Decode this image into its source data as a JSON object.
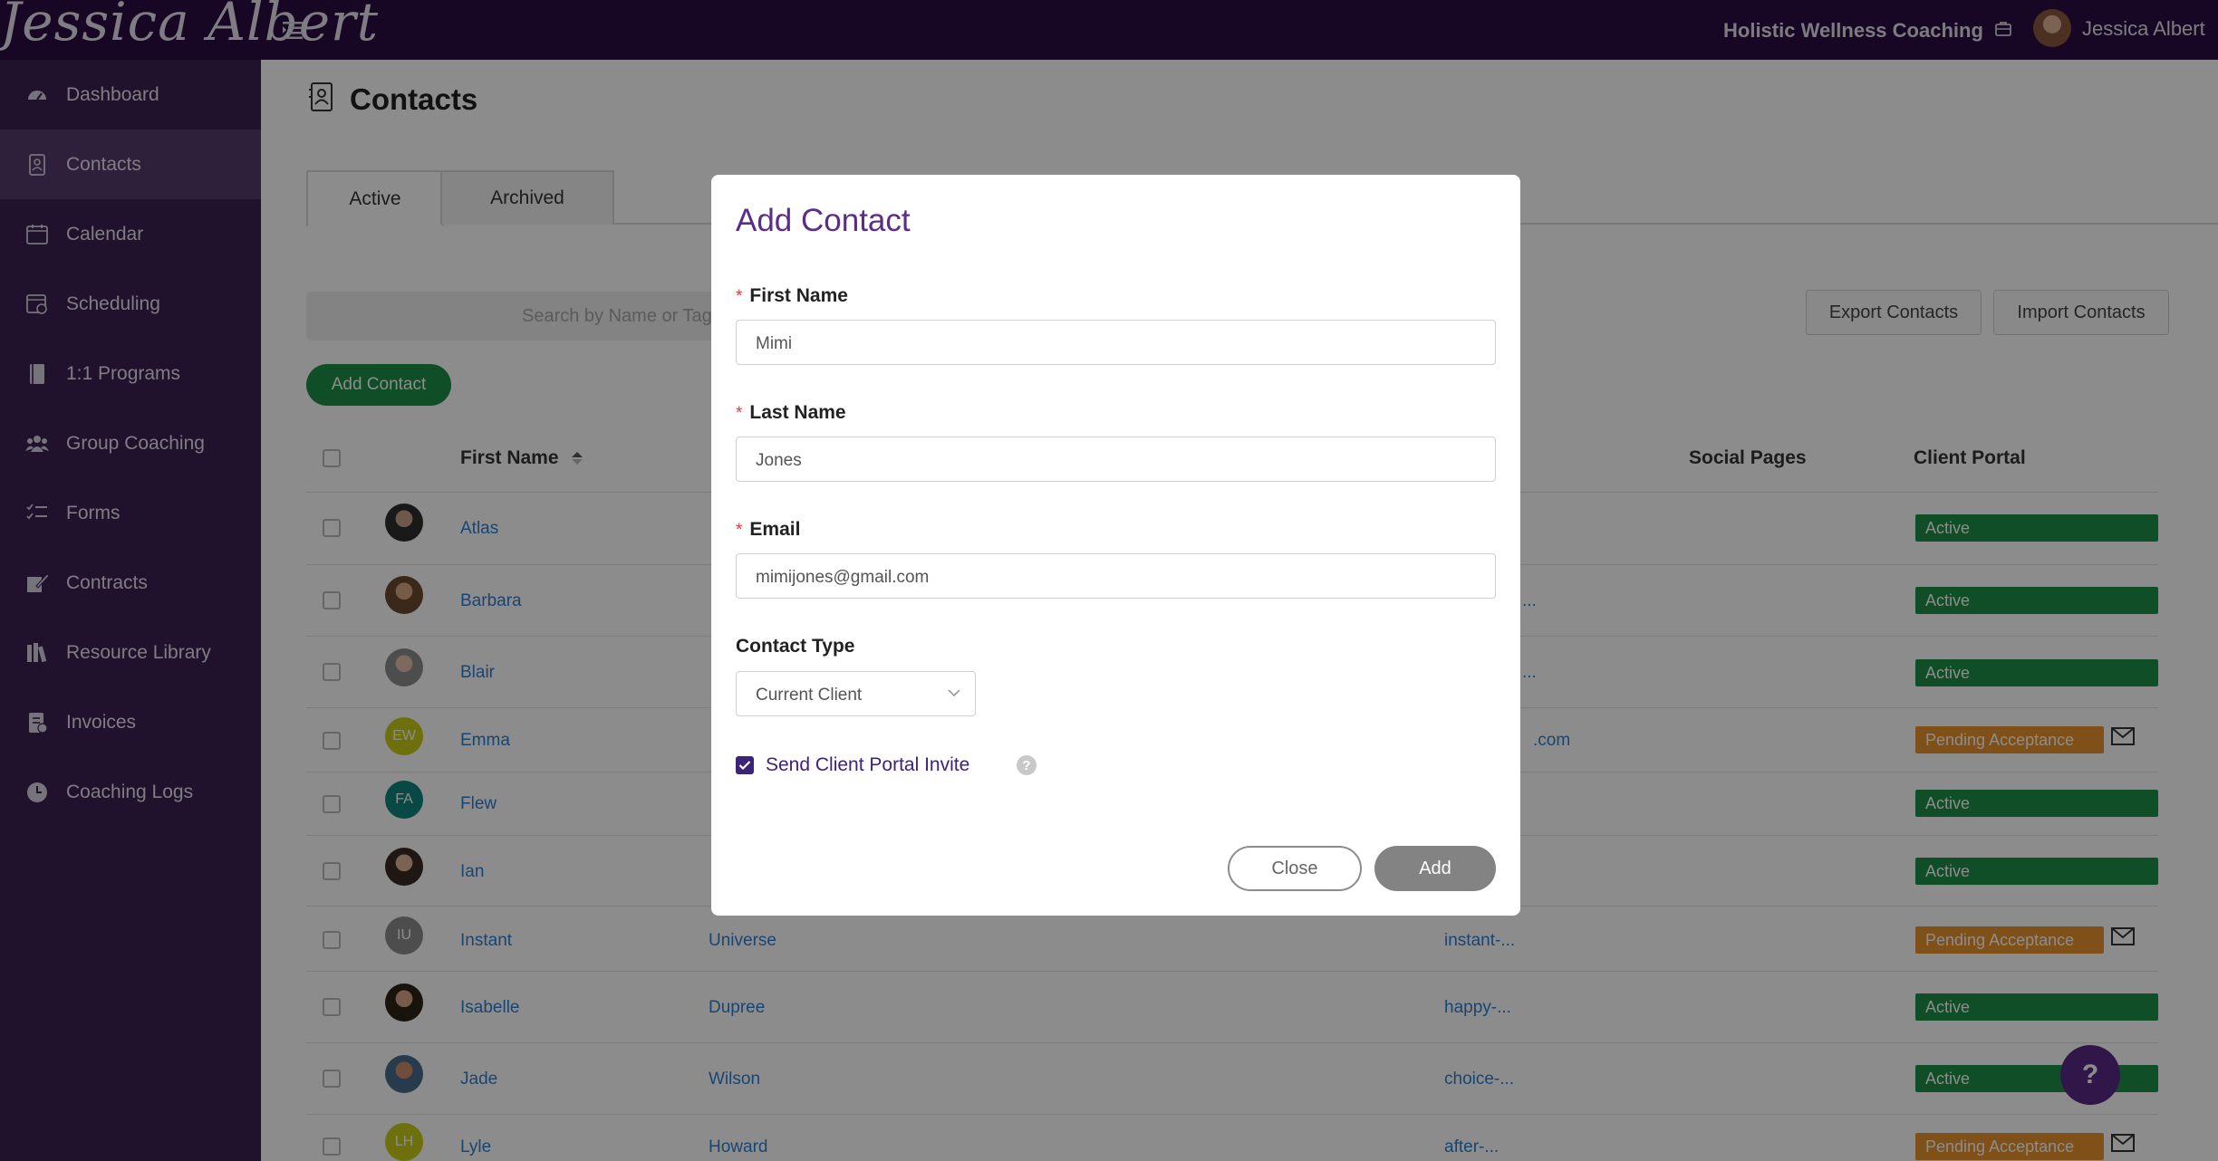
{
  "app": {
    "logo_text": "Jessica Albert",
    "business_name": "Holistic Wellness Coaching",
    "user_name": "Jessica Albert"
  },
  "sidebar": {
    "items": [
      {
        "label": "Dashboard",
        "icon": "dashboard-icon"
      },
      {
        "label": "Contacts",
        "icon": "contacts-icon",
        "active": true
      },
      {
        "label": "Calendar",
        "icon": "calendar-icon"
      },
      {
        "label": "Scheduling",
        "icon": "scheduling-icon"
      },
      {
        "label": "1:1 Programs",
        "icon": "book-icon"
      },
      {
        "label": "Group Coaching",
        "icon": "group-icon"
      },
      {
        "label": "Forms",
        "icon": "forms-icon"
      },
      {
        "label": "Contracts",
        "icon": "contracts-icon"
      },
      {
        "label": "Resource Library",
        "icon": "library-icon"
      },
      {
        "label": "Invoices",
        "icon": "invoice-icon"
      },
      {
        "label": "Coaching Logs",
        "icon": "clock-icon"
      }
    ]
  },
  "page": {
    "title": "Contacts",
    "tabs": [
      "Active",
      "Archived"
    ],
    "search_placeholder": "Search by Name or Tags",
    "export_label": "Export Contacts",
    "import_label": "Import Contacts",
    "add_contact_label": "Add Contact"
  },
  "table": {
    "headers": {
      "first_name": "First Name",
      "social_pages": "Social Pages",
      "client_portal": "Client Portal"
    },
    "rows": [
      {
        "first": "Atlas",
        "last": "",
        "email": "",
        "initials": "",
        "status": "Active"
      },
      {
        "first": "Barbara",
        "last": "",
        "email": "...",
        "initials": "",
        "status": "Active"
      },
      {
        "first": "Blair",
        "last": "",
        "email": "...",
        "initials": "",
        "status": "Active"
      },
      {
        "first": "Emma",
        "last": "",
        "email": ".com",
        "initials": "EW",
        "status": "Pending Acceptance"
      },
      {
        "first": "Flew",
        "last": "",
        "email": "",
        "initials": "FA",
        "status": "Active"
      },
      {
        "first": "Ian",
        "last": "",
        "email": "",
        "initials": "",
        "status": "Active"
      },
      {
        "first": "Instant",
        "last": "Universe",
        "email": "instant-...",
        "initials": "IU",
        "status": "Pending Acceptance"
      },
      {
        "first": "Isabelle",
        "last": "Dupree",
        "email": "happy-...",
        "initials": "",
        "status": "Active"
      },
      {
        "first": "Jade",
        "last": "Wilson",
        "email": "choice-...",
        "initials": "",
        "status": "Active"
      },
      {
        "first": "Lyle",
        "last": "Howard",
        "email": "after-...",
        "initials": "LH",
        "status": "Pending Acceptance"
      }
    ]
  },
  "help": {
    "label": "?"
  },
  "modal": {
    "title": "Add Contact",
    "required_mark": "*",
    "first_name_label": "First Name",
    "first_name_value": "Mimi",
    "last_name_label": "Last Name",
    "last_name_value": "Jones",
    "email_label": "Email",
    "email_value": "mimijones@gmail.com",
    "contact_type_label": "Contact Type",
    "contact_type_value": "Current Client",
    "invite_label": "Send Client Portal Invite",
    "invite_checked": true,
    "help_mark": "?",
    "close_label": "Close",
    "add_label": "Add"
  },
  "colors": {
    "topbar": "#2a0e42",
    "sidebar": "#3b1f52",
    "accent": "#5b2d8a",
    "active_badge": "#1d8e45",
    "pending_badge": "#e8932b",
    "link": "#2f7fcf"
  }
}
